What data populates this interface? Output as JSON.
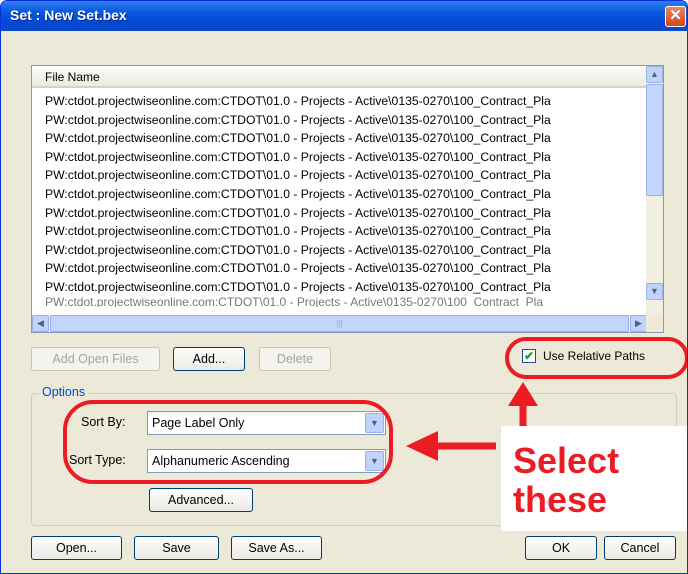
{
  "window": {
    "title": "Set : New Set.bex",
    "close_glyph": "✕"
  },
  "file_list": {
    "column_header": "File Name",
    "rows": [
      "PW:ctdot.projectwiseonline.com:CTDOT\\01.0 - Projects - Active\\0135-0270\\100_Contract_Pla",
      "PW:ctdot.projectwiseonline.com:CTDOT\\01.0 - Projects - Active\\0135-0270\\100_Contract_Pla",
      "PW:ctdot.projectwiseonline.com:CTDOT\\01.0 - Projects - Active\\0135-0270\\100_Contract_Pla",
      "PW:ctdot.projectwiseonline.com:CTDOT\\01.0 - Projects - Active\\0135-0270\\100_Contract_Pla",
      "PW:ctdot.projectwiseonline.com:CTDOT\\01.0 - Projects - Active\\0135-0270\\100_Contract_Pla",
      "PW:ctdot.projectwiseonline.com:CTDOT\\01.0 - Projects - Active\\0135-0270\\100_Contract_Pla",
      "PW:ctdot.projectwiseonline.com:CTDOT\\01.0 - Projects - Active\\0135-0270\\100_Contract_Pla",
      "PW:ctdot.projectwiseonline.com:CTDOT\\01.0 - Projects - Active\\0135-0270\\100_Contract_Pla",
      "PW:ctdot.projectwiseonline.com:CTDOT\\01.0 - Projects - Active\\0135-0270\\100_Contract_Pla",
      "PW:ctdot.projectwiseonline.com:CTDOT\\01.0 - Projects - Active\\0135-0270\\100_Contract_Pla",
      "PW:ctdot.projectwiseonline.com:CTDOT\\01.0 - Projects - Active\\0135-0270\\100_Contract_Pla",
      "PW:ctdot.projectwiseonline.com:CTDOT\\01.0 - Projects - Active\\0135-0270\\100_Contract_Pla"
    ],
    "scroll_up_glyph": "▲",
    "scroll_down_glyph": "▼",
    "scroll_left_glyph": "◀",
    "scroll_right_glyph": "▶",
    "grip_glyph": "|||"
  },
  "file_buttons": {
    "add_open_files": "Add Open Files",
    "add": "Add...",
    "delete": "Delete"
  },
  "relative_paths": {
    "label": "Use Relative Paths",
    "checked": true,
    "check_glyph": "✔"
  },
  "options": {
    "legend": "Options",
    "sort_by": {
      "label": "Sort By:",
      "value": "Page Label Only"
    },
    "sort_type": {
      "label": "Sort Type:",
      "value": "Alphanumeric Ascending"
    },
    "dropdown_glyph": "▼",
    "advanced": "Advanced..."
  },
  "footer_buttons": {
    "open": "Open...",
    "save": "Save",
    "save_as": "Save As...",
    "ok": "OK",
    "cancel": "Cancel"
  },
  "annotation": {
    "text_line1": "Select",
    "text_line2": "these",
    "color": "#ec1c24"
  },
  "colors": {
    "titlebar": "#0a5ae0",
    "dialog_bg": "#ece9d8",
    "legend_blue": "#0046d5"
  }
}
